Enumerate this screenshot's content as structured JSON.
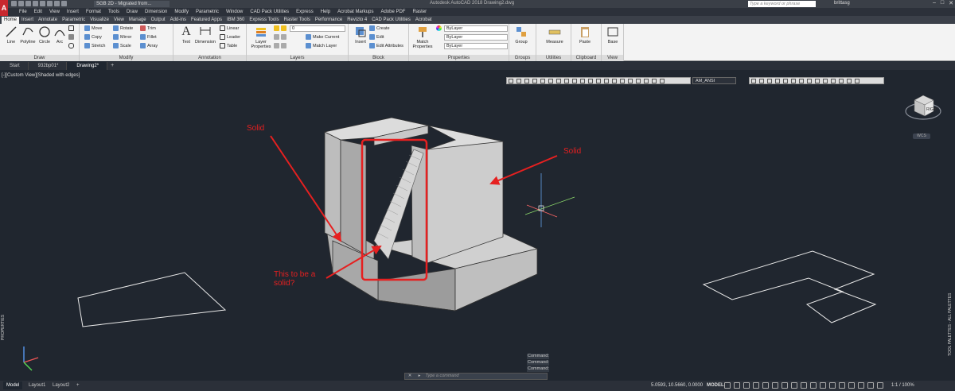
{
  "titlebar": {
    "app_logo": "A",
    "workspace": "SGB 2D - Migrated from...",
    "title": "Autodesk AutoCAD 2018   Drawing2.dwg",
    "search_placeholder": "Type a keyword or phrase",
    "user": "brittasg"
  },
  "menus": [
    "File",
    "Edit",
    "View",
    "Insert",
    "Format",
    "Tools",
    "Draw",
    "Dimension",
    "Modify",
    "Parametric",
    "Window",
    "CAD Pack Utilities",
    "Express",
    "Help",
    "Acrobat Markups",
    "Adobe PDF",
    "Raster"
  ],
  "ribbon_tabs": [
    "Home",
    "Insert",
    "Annotate",
    "Parametric",
    "Visualize",
    "View",
    "Manage",
    "Output",
    "Add-ins",
    "Featured Apps",
    "IBM 360",
    "Express Tools",
    "Raster Tools",
    "Performance",
    "Revizto 4",
    "CAD Pack Utilities",
    "Acrobat"
  ],
  "panels": {
    "draw": {
      "label": "Draw",
      "line": "Line",
      "polyline": "Polyline",
      "circle": "Circle",
      "arc": "Arc"
    },
    "modify": {
      "label": "Modify",
      "move": "Move",
      "rotate": "Rotate",
      "trim": "Trim",
      "copy": "Copy",
      "mirror": "Mirror",
      "fillet": "Fillet",
      "stretch": "Stretch",
      "scale": "Scale",
      "array": "Array"
    },
    "annotation": {
      "label": "Annotation",
      "text": "Text",
      "dimension": "Dimension",
      "linear": "Linear",
      "leader": "Leader",
      "table": "Table"
    },
    "layers": {
      "label": "Layers",
      "layer_properties": "Layer Properties",
      "current_layer": "0",
      "make_current": "Make Current",
      "match_layer": "Match Layer"
    },
    "block": {
      "label": "Block",
      "insert": "Insert",
      "create": "Create",
      "edit": "Edit",
      "edit_attributes": "Edit Attributes"
    },
    "properties": {
      "label": "Properties",
      "match_properties": "Match Properties",
      "color": "ByLayer",
      "linetype": "ByLayer",
      "lineweight": "ByLayer"
    },
    "groups": {
      "label": "Groups",
      "group": "Group"
    },
    "utilities": {
      "label": "Utilities",
      "measure": "Measure"
    },
    "clipboard": {
      "label": "Clipboard",
      "paste": "Paste"
    },
    "view": {
      "label": "View",
      "base": "Base"
    }
  },
  "file_tabs": [
    "Start",
    "932bp01*",
    "Drawing2*"
  ],
  "viewport": {
    "label": "[-][Custom View][Shaded with edges]",
    "dim_style": "AM_ANSI",
    "viewcube_face": "RIGHT",
    "wcs": "WCS",
    "annotations": {
      "solid_left": "Solid",
      "solid_right": "Solid",
      "question": "This to be a solid?"
    }
  },
  "command": {
    "history": [
      "Command:",
      "Command:",
      "Command:"
    ],
    "placeholder": "Type a command"
  },
  "side_labels": {
    "left": "PROPERTIES",
    "right": "TOOL PALETTES - ALL PALETTES"
  },
  "statusbar": {
    "layouts": [
      "Model",
      "Layout1",
      "Layout2"
    ],
    "coords": "5.0593, 10.5660, 0.0000",
    "mode": "MODEL",
    "zoom": "1:1 / 100%"
  },
  "colors": {
    "annotation": "#e62020",
    "viewport_bg": "#20262f",
    "app_red": "#c8282e"
  }
}
